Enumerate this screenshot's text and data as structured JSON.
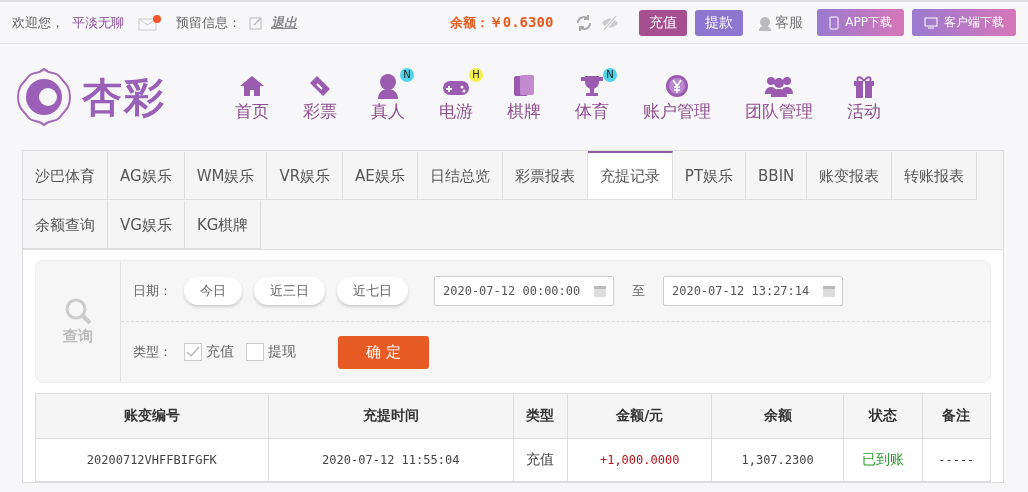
{
  "top_bar": {
    "welcome": "欢迎您，",
    "username": "平淡无聊",
    "mail_unread": true,
    "reserved_label": "预留信息：",
    "logout": "退出",
    "balance_label": "余额：",
    "balance": "￥0.6300",
    "buttons": [
      {
        "label": "充值",
        "kind": "deposit"
      },
      {
        "label": "提款",
        "kind": "withdraw"
      }
    ],
    "service": "客服",
    "downloads": [
      {
        "label": "APP下载",
        "kind": "phone"
      },
      {
        "label": "客户端下载",
        "kind": "desktop"
      }
    ]
  },
  "logo": {
    "text": "杏彩"
  },
  "nav": [
    {
      "label": "首页"
    },
    {
      "label": "彩票"
    },
    {
      "label": "真人",
      "badge": {
        "text": "N",
        "color": "#4fd3ea"
      }
    },
    {
      "label": "电游",
      "badge": {
        "text": "H",
        "color": "#f5f04a"
      }
    },
    {
      "label": "棋牌"
    },
    {
      "label": "体育",
      "badge": {
        "text": "N",
        "color": "#4fd3ea"
      }
    },
    {
      "label": "账户管理"
    },
    {
      "label": "团队管理"
    },
    {
      "label": "活动"
    }
  ],
  "tabs": [
    {
      "label": "沙巴体育",
      "selected": false
    },
    {
      "label": "AG娱乐",
      "selected": false
    },
    {
      "label": "WM娱乐",
      "selected": false
    },
    {
      "label": "VR娱乐",
      "selected": false
    },
    {
      "label": "AE娱乐",
      "selected": false
    },
    {
      "label": "日结总览",
      "selected": false
    },
    {
      "label": "彩票报表",
      "selected": false
    },
    {
      "label": "充提记录",
      "selected": true
    },
    {
      "label": "PT娱乐",
      "selected": false
    },
    {
      "label": "BBIN",
      "selected": false
    },
    {
      "label": "账变报表",
      "selected": false
    },
    {
      "label": "转账报表",
      "selected": false
    },
    {
      "label": "余额查询",
      "selected": false
    },
    {
      "label": "VG娱乐",
      "selected": false
    },
    {
      "label": "KG棋牌",
      "selected": false
    }
  ],
  "filter": {
    "query_label": "查询",
    "date_label": "日期：",
    "quick_dates": [
      "今日",
      "近三日",
      "近七日"
    ],
    "start": "2020-07-12 00:00:00",
    "to_label": "至",
    "end": "2020-07-12 13:27:14",
    "type_label": "类型：",
    "types": [
      {
        "label": "充值",
        "checked": true
      },
      {
        "label": "提现",
        "checked": false
      }
    ],
    "confirm": "确 定"
  },
  "table": {
    "columns": [
      "账变编号",
      "充提时间",
      "类型",
      "金额/元",
      "余额",
      "状态",
      "备注"
    ],
    "rows": [
      {
        "id": "20200712VHFFBIFGFK",
        "time": "2020-07-12 11:55:04",
        "type": "充值",
        "amount": "+1,000.0000",
        "balance": "1,307.2300",
        "status": "已到账",
        "note": "-----"
      }
    ]
  }
}
